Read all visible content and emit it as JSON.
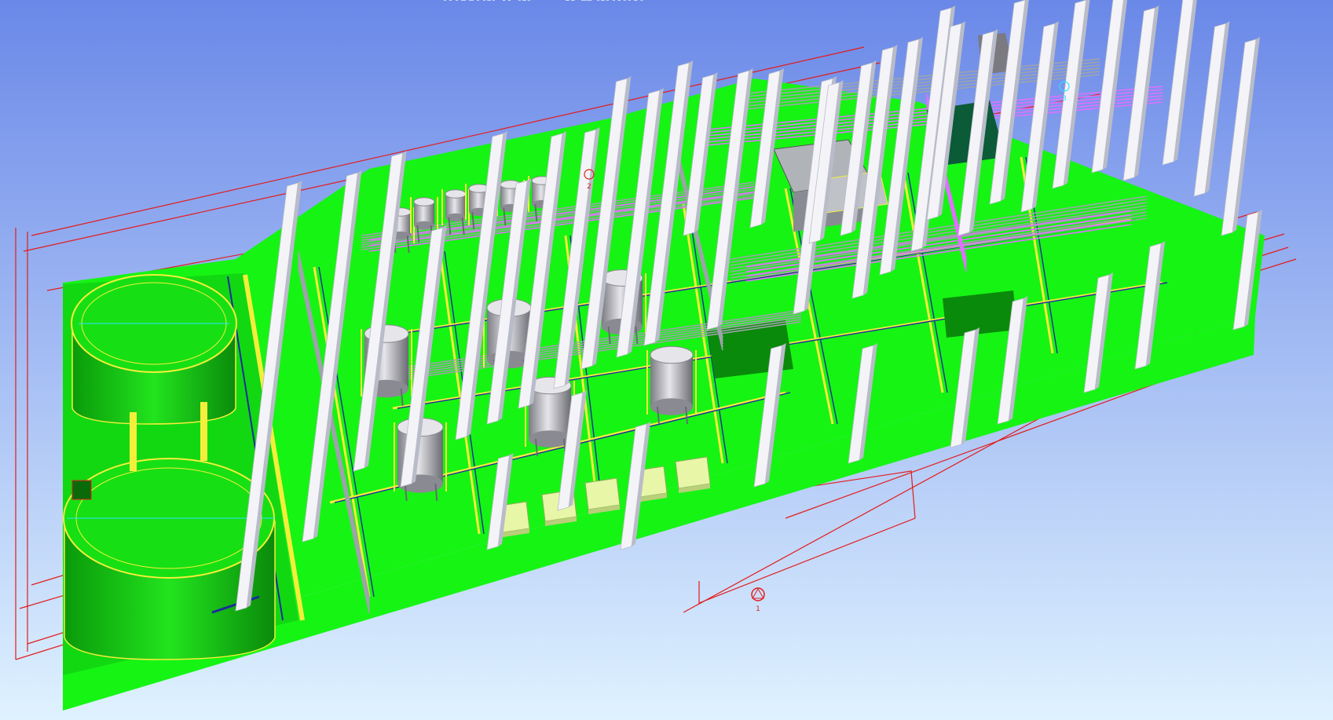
{
  "app": {
    "view_title": ""
  },
  "colors": {
    "sky_top": "#6a88e8",
    "sky_bottom": "#dff2ff",
    "floor": "#16f414",
    "floor_dark": "#0ea00c",
    "pit_wall": "#0a8a0a",
    "column": "#f4f4f8",
    "column_shade": "#b9bcc8",
    "pipe_gray": "#9ea3aa",
    "pipe_pink": "#e070ff",
    "railing": "#f4ef3a",
    "dimension": "#e21c1c",
    "vessel": "#c8c8cc",
    "pallet": "#e8f6a8"
  },
  "scene": {
    "dimension_labels": [
      "",
      ""
    ],
    "marker_labels": [
      "1",
      "2",
      "3"
    ]
  }
}
